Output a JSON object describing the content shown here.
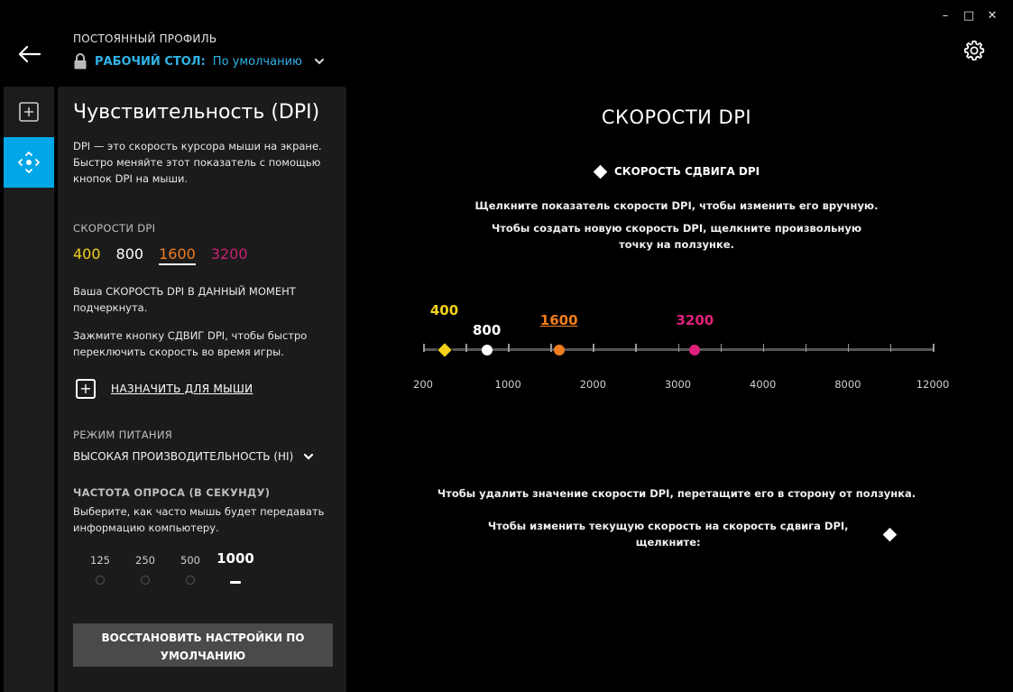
{
  "window": {
    "minimize": "–",
    "maximize": "□",
    "close": "✕"
  },
  "header": {
    "profile_label": "ПОСТОЯННЫЙ ПРОФИЛЬ",
    "profile_name": "РАБОЧИЙ СТОЛ:",
    "profile_value": "По умолчанию"
  },
  "panel": {
    "title": "Чувствительность (DPI)",
    "description": "DPI — это скорость курсора мыши на экране. Быстро меняйте этот показатель с помощью кнопок DPI на мыши.",
    "dpi_speeds_label": "СКОРОСТИ DPI",
    "dpi_speeds": [
      {
        "value": "400",
        "color": "#f2d21b"
      },
      {
        "value": "800",
        "color": "#ffffff"
      },
      {
        "value": "1600",
        "color": "#f07d1e"
      },
      {
        "value": "3200",
        "color": "#c8206f"
      }
    ],
    "current_note": "Ваша СКОРОСТЬ DPI В ДАННЫЙ МОМЕНТ подчеркнута.",
    "shift_note": "Зажмите кнопку СДВИГ DPI, чтобы быстро переключить скорость во время игры.",
    "assign_label": "НАЗНАЧИТЬ ДЛЯ МЫШИ",
    "power_label": "РЕЖИМ ПИТАНИЯ",
    "power_value": "ВЫСОКАЯ ПРОИЗВОДИТЕЛЬНОСТЬ (HI)",
    "poll_label": "ЧАСТОТА ОПРОСА (В СЕКУНДУ)",
    "poll_desc": "Выберите, как часто мышь будет передавать информацию компьютеру.",
    "poll_options": [
      "125",
      "250",
      "500",
      "1000"
    ],
    "poll_selected": "1000",
    "reset_label": "ВОССТАНОВИТЬ НАСТРОЙКИ ПО УМОЛЧАНИЮ"
  },
  "main": {
    "title": "СКОРОСТИ DPI",
    "shift_label": "СКОРОСТЬ СДВИГА DPI",
    "hint_edit": "Щелкните показатель скорости DPI, чтобы изменить его вручную.",
    "hint_create": "Чтобы создать новую скорость DPI, щелкните произвольную точку на ползунке.",
    "hint_delete": "Чтобы удалить значение скорости DPI, перетащите его в сторону от ползунка.",
    "hint_shift": "Чтобы изменить текущую скорость на скорость сдвига DPI, щелкните:",
    "axis_labels": [
      "200",
      "1000",
      "2000",
      "3000",
      "4000",
      "8000",
      "12000"
    ],
    "markers": [
      {
        "label": "400",
        "dpi": 400,
        "color": "#f2d21b",
        "shape": "diamond",
        "underline": false
      },
      {
        "label": "800",
        "dpi": 800,
        "color": "#ffffff",
        "shape": "circle",
        "underline": false
      },
      {
        "label": "1600",
        "dpi": 1600,
        "color": "#f07d1e",
        "shape": "circle",
        "underline": true
      },
      {
        "label": "3200",
        "dpi": 3200,
        "color": "#e0207a",
        "shape": "circle",
        "underline": false
      }
    ]
  }
}
